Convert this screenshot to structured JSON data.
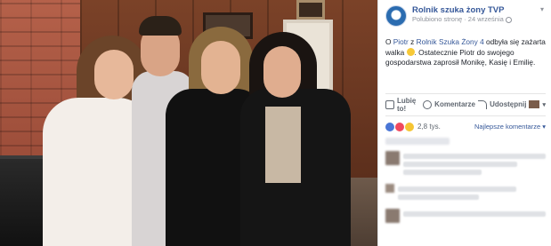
{
  "post": {
    "page_name": "Rolnik szuka żony TVP",
    "meta_prefix": "Polubiono stronę",
    "meta_sep": "·",
    "date": "24 września",
    "text_before": "O ",
    "link_person": "Piotr",
    "text_z": " z ",
    "link_show": "Rolnik Szuka Żony 4",
    "text_after": " odbyła się zażarta walka",
    "text_tail": ". Ostatecznie Piotr do swojego gospodarstwa zaprosił Monikę, Kasię i Emilię."
  },
  "actions": {
    "like_label": "Lubię to!",
    "comment_label": "Komentarze",
    "share_label": "Udostępnij"
  },
  "reactions": {
    "count": "2,8 tys.",
    "sort_label": "Najlepsze komentarze ▾"
  },
  "colors": {
    "brand_blue": "#365899",
    "like_blue": "#4a76d6",
    "love_red": "#f0495e",
    "wow_yellow": "#f5c533"
  }
}
